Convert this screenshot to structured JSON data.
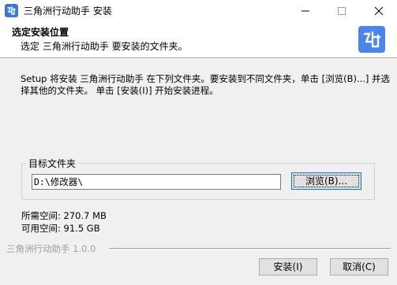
{
  "window": {
    "title": "三角洲行动助手 安装",
    "controls": {
      "minimize_icon": "minimize-icon",
      "maximize_icon": "maximize-icon",
      "close_icon": "close-icon"
    }
  },
  "header": {
    "title": "选定安装位置",
    "subtitle": "选定 三角洲行动助手 要安装的文件夹。",
    "logo_icon": "app-logo-icon"
  },
  "description": "Setup 将安装 三角洲行动助手 在下列文件夹。要安装到不同文件夹，单击 [浏览(B)...] 并选择其他的文件夹。 单击 [安装(I)] 开始安装进程。",
  "destination": {
    "group_label": "目标文件夹",
    "path_value": "D:\\修改器\\",
    "browse_label": "浏览(B)..."
  },
  "space": {
    "required": "所需空间: 270.7 MB",
    "available": "可用空间: 91.5 GB"
  },
  "footer": {
    "brand": "三角洲行动助手 1.0.0",
    "install_label": "安装(I)",
    "cancel_label": "取消(C)"
  },
  "colors": {
    "accent": "#0078d7",
    "logo_bg": "#4a86e8",
    "window_bg": "#f0f0f0"
  }
}
